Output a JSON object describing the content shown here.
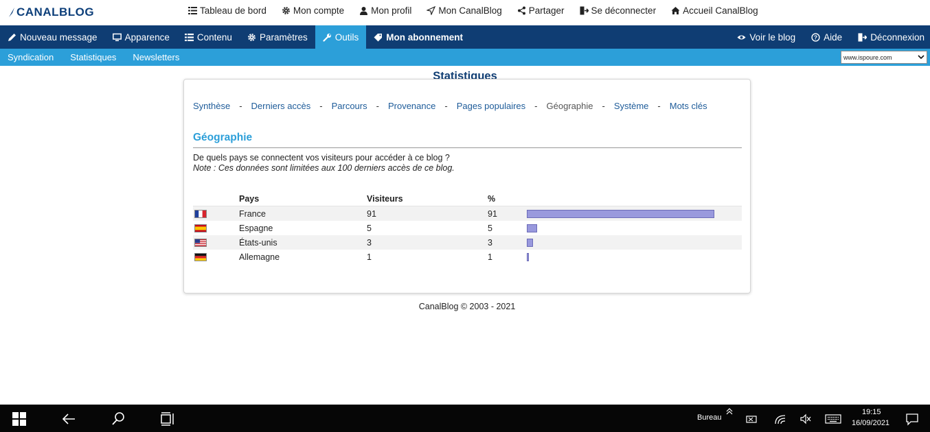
{
  "topbar": {
    "logo": "CANALBLOG",
    "links": [
      {
        "label": "Tableau de bord",
        "icon": "dashboard-list-icon"
      },
      {
        "label": "Mon compte",
        "icon": "gear-icon"
      },
      {
        "label": "Mon profil",
        "icon": "user-icon"
      },
      {
        "label": "Mon CanalBlog",
        "icon": "paper-plane-icon"
      },
      {
        "label": "Partager",
        "icon": "share-icon"
      },
      {
        "label": "Se déconnecter",
        "icon": "logout-icon"
      },
      {
        "label": "Accueil CanalBlog",
        "icon": "home-icon"
      }
    ]
  },
  "mainnav": {
    "items": [
      {
        "label": "Nouveau message",
        "icon": "pencil-icon"
      },
      {
        "label": "Apparence",
        "icon": "monitor-icon"
      },
      {
        "label": "Contenu",
        "icon": "list-icon"
      },
      {
        "label": "Paramètres",
        "icon": "gear-icon"
      },
      {
        "label": "Outils",
        "icon": "wrench-icon"
      },
      {
        "label": "Mon abonnement",
        "icon": "tag-icon"
      }
    ],
    "active": "Outils",
    "right": [
      {
        "label": "Voir le blog",
        "icon": "eye-icon"
      },
      {
        "label": "Aide",
        "icon": "help-icon"
      },
      {
        "label": "Déconnexion",
        "icon": "logout-icon"
      }
    ]
  },
  "subnav": {
    "items": [
      "Syndication",
      "Statistiques",
      "Newsletters"
    ],
    "blog_select": "www.ispoure.com"
  },
  "page": {
    "title": "Statistiques",
    "statnav": [
      "Synthèse",
      "Derniers accès",
      "Parcours",
      "Provenance",
      "Pages populaires",
      "Géographie",
      "Système",
      "Mots clés"
    ],
    "statnav_current": "Géographie",
    "separator": "-",
    "section_title": "Géographie",
    "question": "De quels pays se connectent vos visiteurs pour accéder à ce blog ?",
    "note": "Note : Ces données sont limitées aux 100 derniers accès de ce blog.",
    "table": {
      "headers": {
        "pays": "Pays",
        "visiteurs": "Visiteurs",
        "pct": "%"
      },
      "rows": [
        {
          "pays": "France",
          "visiteurs": "91",
          "pct": "91",
          "flag": "fr"
        },
        {
          "pays": "Espagne",
          "visiteurs": "5",
          "pct": "5",
          "flag": "es"
        },
        {
          "pays": "États-unis",
          "visiteurs": "3",
          "pct": "3",
          "flag": "us"
        },
        {
          "pays": "Allemagne",
          "visiteurs": "1",
          "pct": "1",
          "flag": "de"
        }
      ]
    }
  },
  "footer": "CanalBlog © 2003 - 2021",
  "taskbar": {
    "bureau": "Bureau",
    "time": "19:15",
    "date": "16/09/2021"
  },
  "colors": {
    "mainnav_bg": "#0f3d73",
    "accent": "#2c9fd9",
    "bar_fill": "#9999dd"
  }
}
